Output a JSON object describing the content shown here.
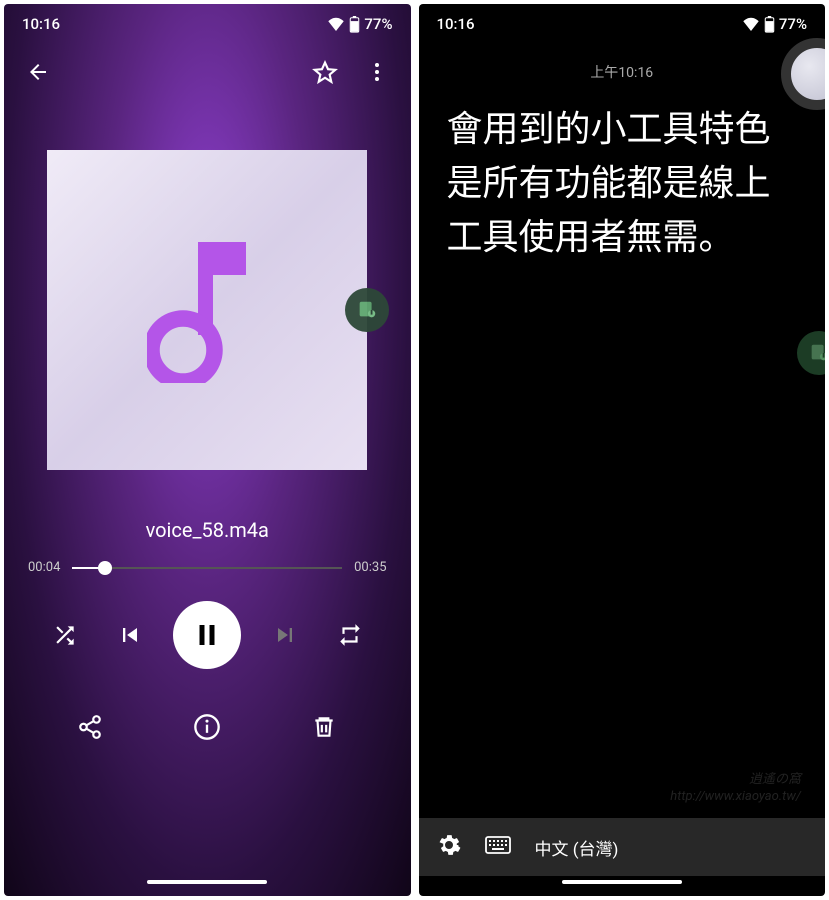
{
  "status": {
    "time": "10:16",
    "battery": "77%"
  },
  "player": {
    "track_name": "voice_58.m4a",
    "elapsed": "00:04",
    "duration": "00:35"
  },
  "transcription": {
    "header_time": "上午10:16",
    "text": "會用到的小工具特色是所有功能都是線上工具使用者無需。",
    "language": "中文 (台灣)"
  },
  "watermark": {
    "line1": "逍遙の窩",
    "line2": "http://www.xiaoyao.tw/"
  }
}
